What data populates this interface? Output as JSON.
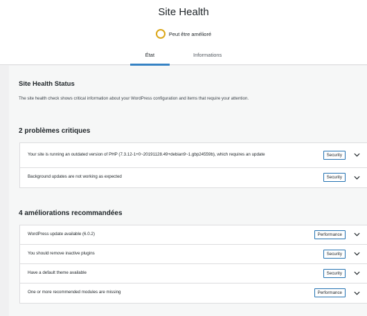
{
  "header": {
    "title": "Site Health",
    "status": "Peut être amélioré",
    "tabs": [
      {
        "label": "État"
      },
      {
        "label": "Informations"
      }
    ]
  },
  "status_panel": {
    "heading": "Site Health Status",
    "description": "The site health check shows critical information about your WordPress configuration and items that require your attention."
  },
  "critical": {
    "title": "2 problèmes critiques",
    "items": [
      {
        "text": "Your site is running an outdated version of PHP (7.3.12-1+0~20191128.49+debian9~1.gbp24559b), which requires an update",
        "badge": "Security"
      },
      {
        "text": "Background updates are not working as expected",
        "badge": "Security"
      }
    ]
  },
  "recommended": {
    "title": "4 améliorations recommandées",
    "items": [
      {
        "text": "WordPress update available (6.0.2)",
        "badge": "Performance"
      },
      {
        "text": "You should remove inactive plugins",
        "badge": "Security"
      },
      {
        "text": "Have a default theme available",
        "badge": "Security"
      },
      {
        "text": "One or more recommended modules are missing",
        "badge": "Performance"
      }
    ]
  },
  "colors": {
    "accent": "#3582c4",
    "warning": "#dba617",
    "badge_border": "#2271b1"
  }
}
